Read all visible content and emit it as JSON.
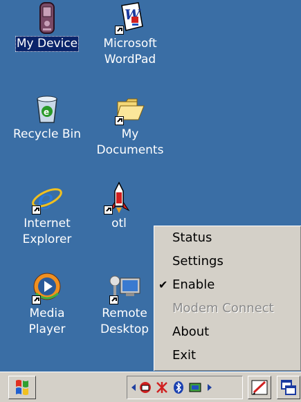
{
  "desktop": {
    "icons": [
      {
        "label": "My Device"
      },
      {
        "label": "Microsoft\nWordPad"
      },
      {
        "label": "Recycle Bin"
      },
      {
        "label": "My\nDocuments"
      },
      {
        "label": "Internet\nExplorer"
      },
      {
        "label": "otl"
      },
      {
        "label": "Media\nPlayer"
      },
      {
        "label": "Remote\nDesktop"
      }
    ]
  },
  "context_menu": {
    "items": [
      {
        "label": "Status",
        "enabled": true,
        "checked": false
      },
      {
        "label": "Settings",
        "enabled": true,
        "checked": false
      },
      {
        "label": "Enable",
        "enabled": true,
        "checked": true
      },
      {
        "label": "Modem Connect",
        "enabled": false,
        "checked": false
      },
      {
        "label": "About",
        "enabled": true,
        "checked": false
      },
      {
        "label": "Exit",
        "enabled": true,
        "checked": false
      }
    ]
  },
  "taskbar": {
    "start_icon": "windows-flag-icon",
    "tray_icons": [
      "scroll-left-icon",
      "network-icon",
      "bluetooth-disabled-icon",
      "bluetooth-icon",
      "connection-icon",
      "scroll-right-icon"
    ],
    "pen_icon": "pen-input-icon",
    "switch_icon": "window-switch-icon"
  },
  "colors": {
    "desktop": "#3a6ea5",
    "selection": "#0a246a",
    "chrome": "#d4d0c8"
  }
}
